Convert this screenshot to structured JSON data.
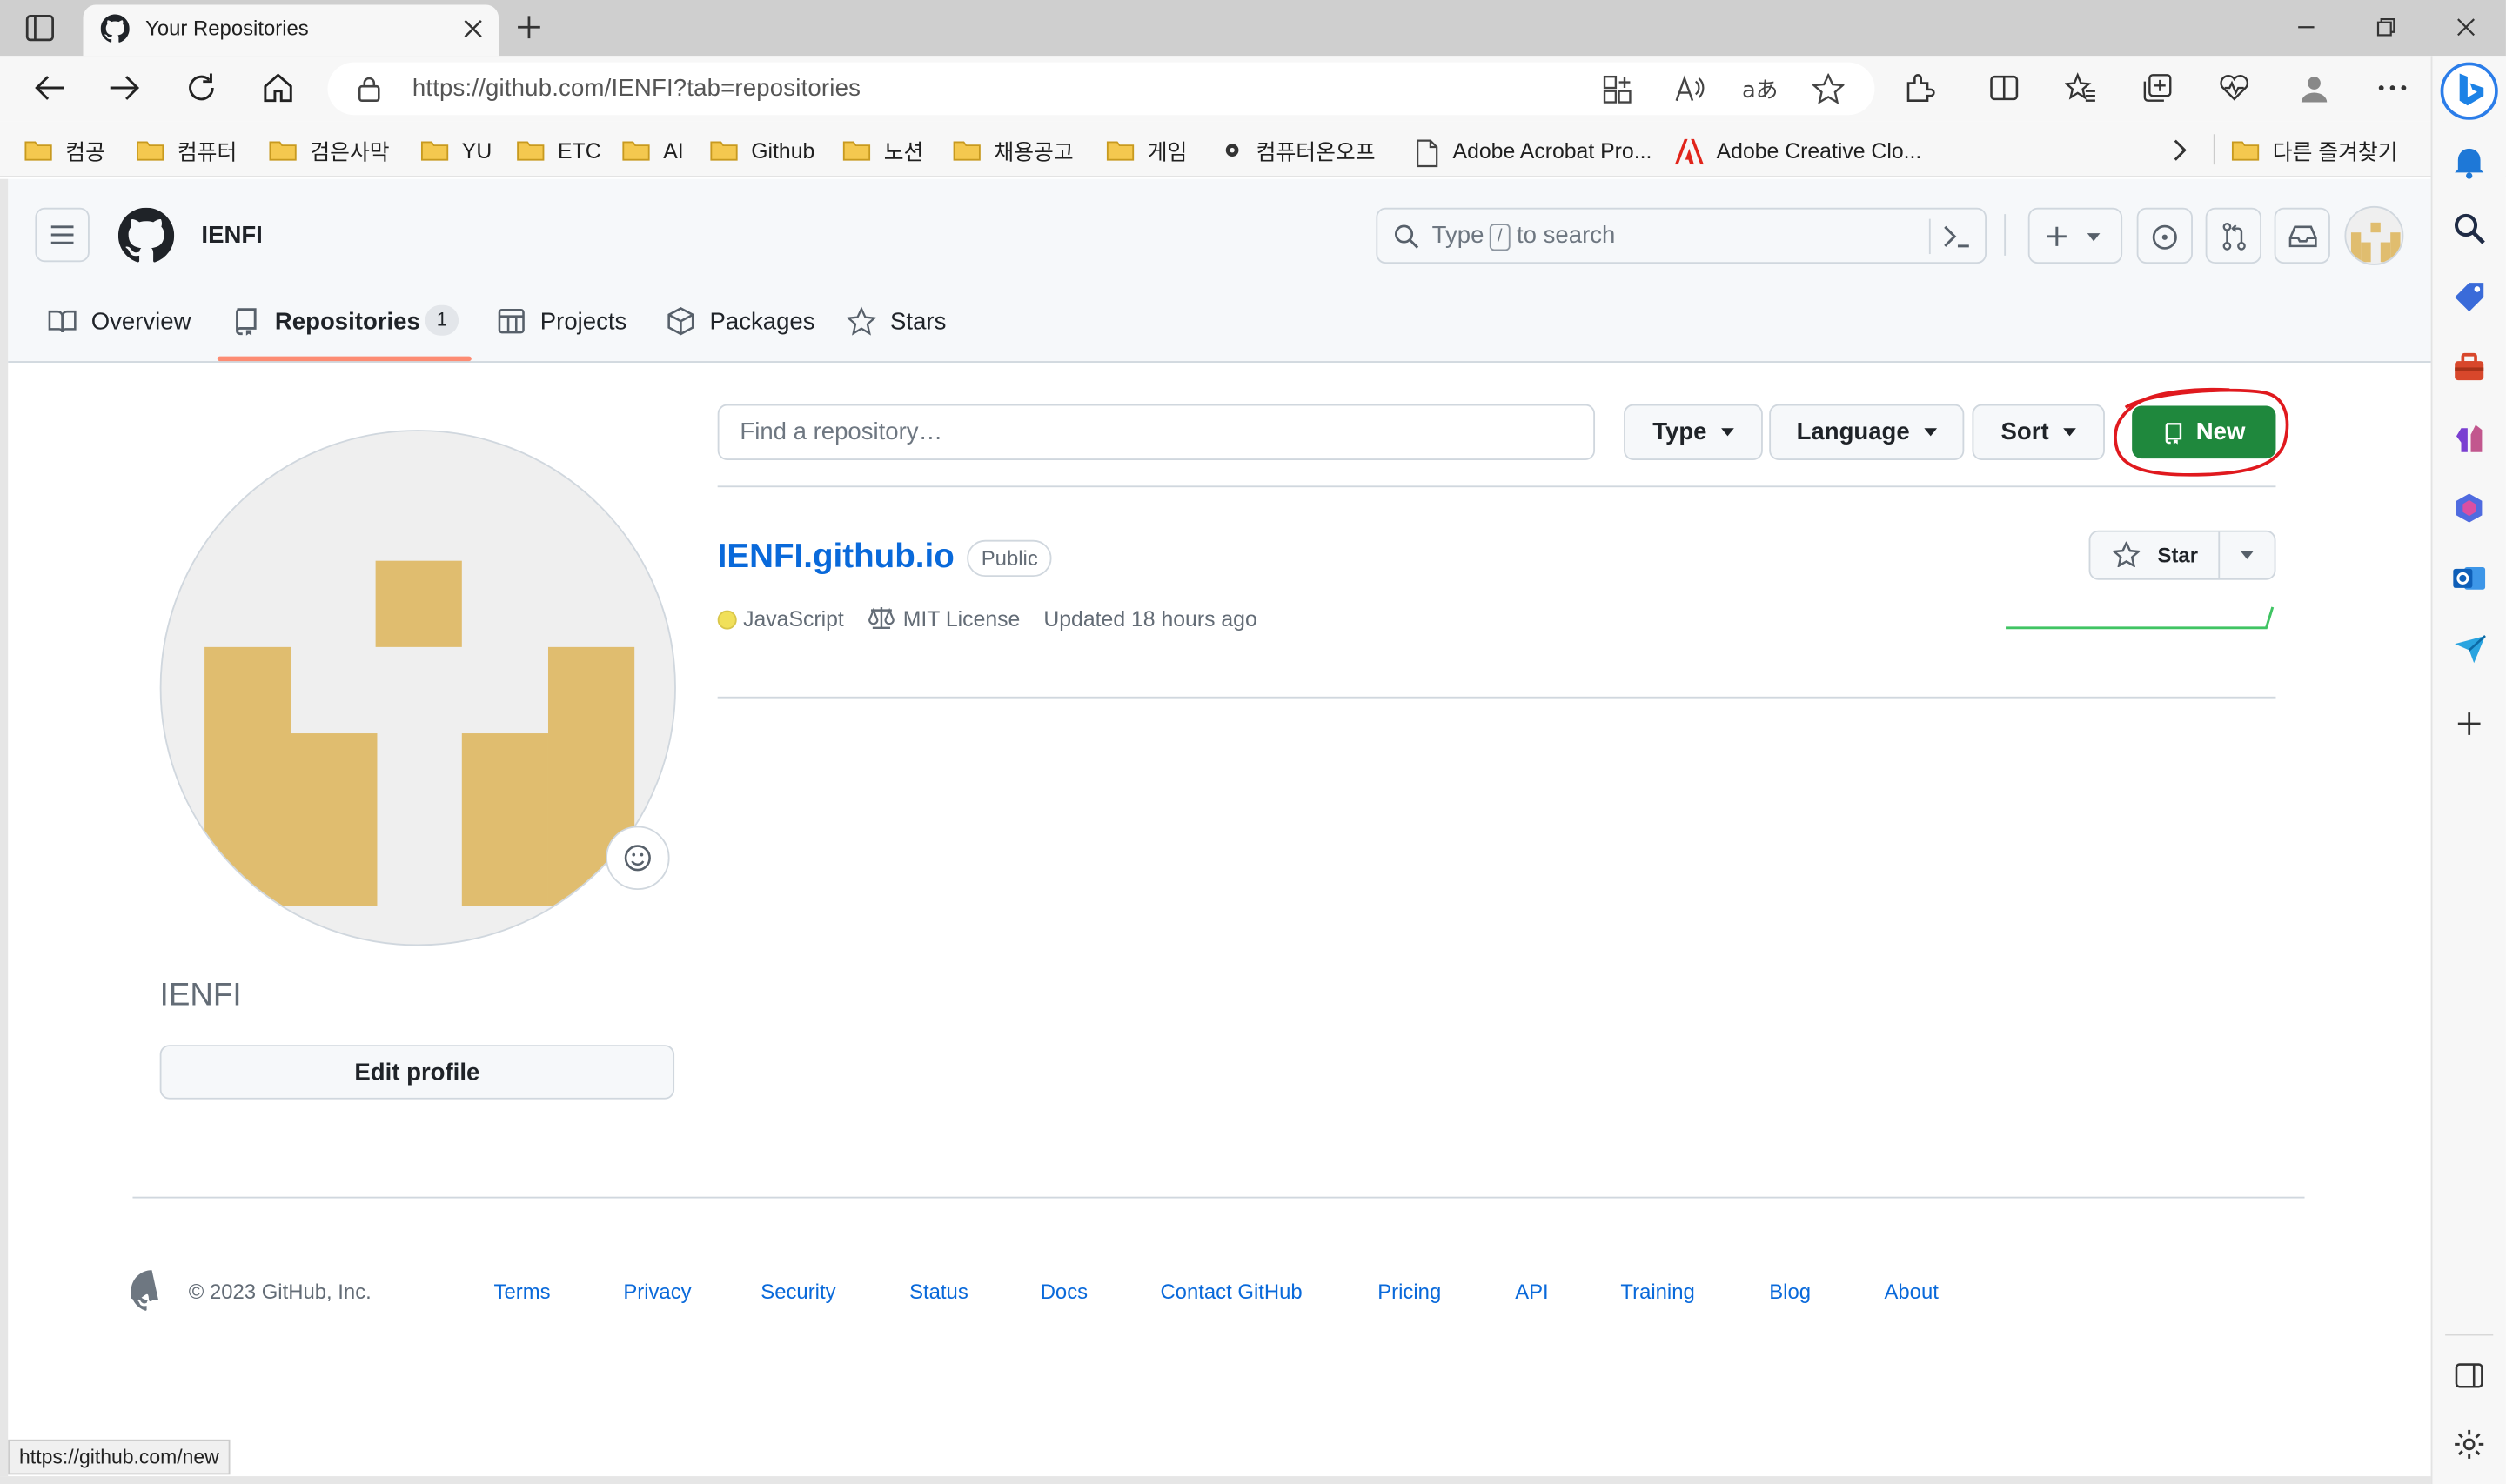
{
  "browser": {
    "tab_title": "Your Repositories",
    "url": "https://github.com/IENFI?tab=repositories",
    "status_url": "https://github.com/new",
    "bookmarks": [
      "컴공",
      "컴퓨터",
      "검은사막",
      "YU",
      "ETC",
      "AI",
      "Github",
      "노션",
      "채용공고",
      "게임",
      "컴퓨터온오프",
      "Adobe Acrobat Pro...",
      "Adobe Creative Clo..."
    ],
    "other_bookmarks": "다른 즐겨찾기"
  },
  "header": {
    "username": "IENFI",
    "search_prefix": "Type",
    "search_key": "/",
    "search_suffix": "to search"
  },
  "tabs": {
    "overview": "Overview",
    "repositories": "Repositories",
    "repositories_count": "1",
    "projects": "Projects",
    "packages": "Packages",
    "stars": "Stars"
  },
  "profile": {
    "name": "IENFI",
    "edit_label": "Edit profile"
  },
  "filters": {
    "find_placeholder": "Find a repository…",
    "type": "Type",
    "language": "Language",
    "sort": "Sort",
    "new": "New"
  },
  "repo": {
    "name": "IENFI.github.io",
    "visibility": "Public",
    "language": "JavaScript",
    "license": "MIT License",
    "updated": "Updated 18 hours ago",
    "star_label": "Star"
  },
  "footer": {
    "copyright": "© 2023 GitHub, Inc.",
    "links": [
      "Terms",
      "Privacy",
      "Security",
      "Status",
      "Docs",
      "Contact GitHub",
      "Pricing",
      "API",
      "Training",
      "Blog",
      "About"
    ]
  },
  "colors": {
    "accent_green": "#1f883d",
    "link_blue": "#0969da",
    "avatar_tan": "#e0bd6f",
    "tab_underline": "#fd8c73",
    "annotation_red": "#e0191e",
    "javascript_yellow": "#f1e05a"
  }
}
